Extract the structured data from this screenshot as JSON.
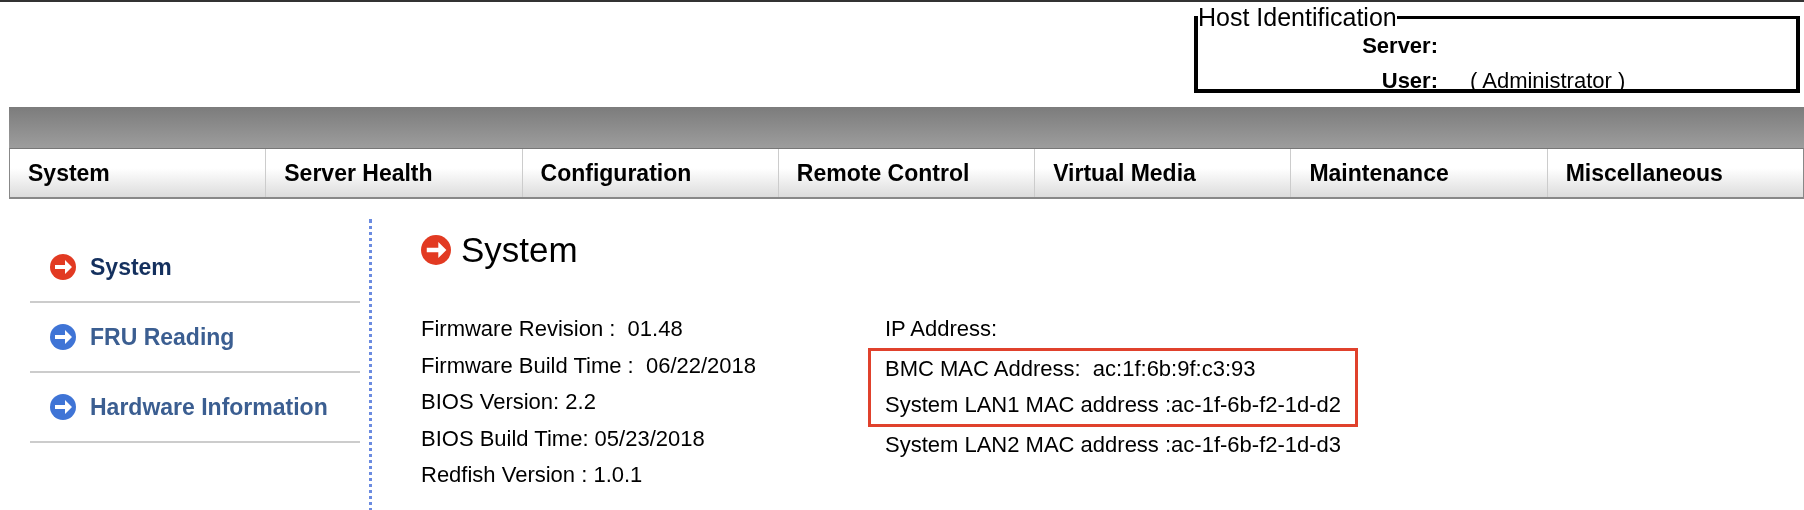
{
  "host_identification": {
    "title": "Host Identification",
    "rows": [
      {
        "label": "Server:",
        "value": ""
      },
      {
        "label": "User:",
        "value": "( Administrator )"
      }
    ]
  },
  "nav_tabs": [
    {
      "label": "System"
    },
    {
      "label": "Server Health"
    },
    {
      "label": "Configuration"
    },
    {
      "label": "Remote Control"
    },
    {
      "label": "Virtual Media"
    },
    {
      "label": "Maintenance"
    },
    {
      "label": "Miscellaneous"
    }
  ],
  "sidebar": {
    "items": [
      {
        "label": "System",
        "selected": true
      },
      {
        "label": "FRU Reading",
        "selected": false
      },
      {
        "label": "Hardware Information",
        "selected": false
      }
    ]
  },
  "content": {
    "title": "System",
    "left_info": [
      "Firmware Revision :  01.48",
      "Firmware Build Time :  06/22/2018",
      "BIOS Version: 2.2",
      "BIOS Build Time: 05/23/2018",
      "Redfish Version : 1.0.1"
    ],
    "right_info": [
      {
        "text": "IP Address:",
        "highlighted": false
      },
      {
        "text": "BMC MAC Address:  ac:1f:6b:9f:c3:93",
        "highlighted": true
      },
      {
        "text": "System LAN1 MAC address :ac-1f-6b-f2-1d-d2",
        "highlighted": true
      },
      {
        "text": "System LAN2 MAC address :ac-1f-6b-f2-1d-d3",
        "highlighted": false
      }
    ]
  }
}
